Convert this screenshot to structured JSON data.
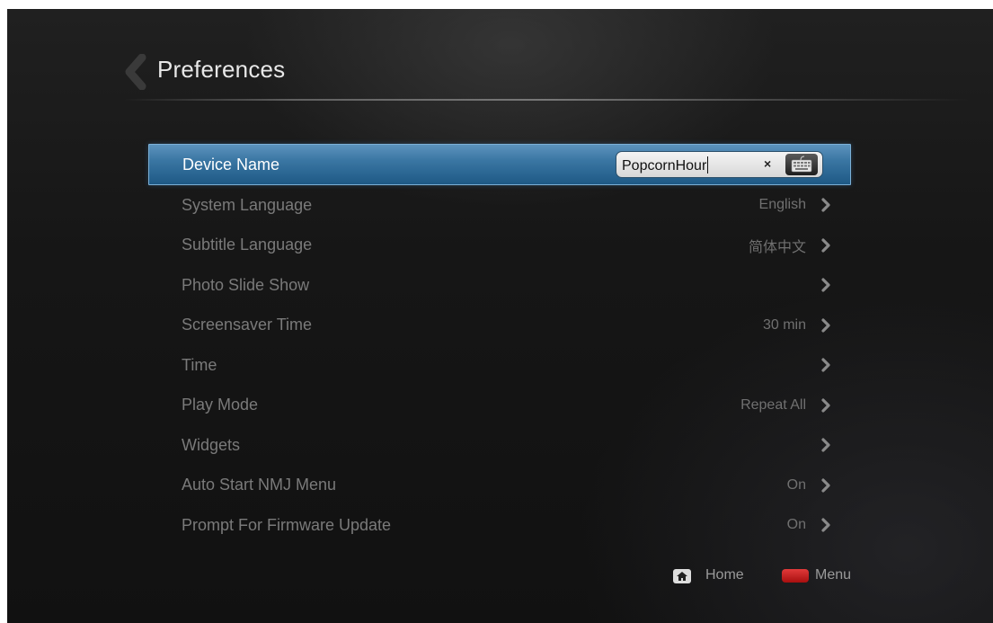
{
  "header": {
    "title": "Preferences"
  },
  "device_name": {
    "value": "PopcornHour",
    "clear_symbol": "×"
  },
  "settings": [
    {
      "label": "Device Name",
      "value": ""
    },
    {
      "label": "System Language",
      "value": "English"
    },
    {
      "label": "Subtitle Language",
      "value": "简体中文"
    },
    {
      "label": "Photo Slide Show",
      "value": ""
    },
    {
      "label": "Screensaver Time",
      "value": "30 min"
    },
    {
      "label": "Time",
      "value": ""
    },
    {
      "label": "Play Mode",
      "value": "Repeat All"
    },
    {
      "label": "Widgets",
      "value": ""
    },
    {
      "label": "Auto Start NMJ Menu",
      "value": "On"
    },
    {
      "label": "Prompt For Firmware Update",
      "value": "On"
    }
  ],
  "footer": {
    "home_label": "Home",
    "menu_label": "Menu"
  },
  "colors": {
    "selection": "#3a76a3",
    "menu_button": "#d22b2b"
  },
  "icons": [
    "back-chevron-icon",
    "keyboard-icon",
    "chevron-right-icon",
    "home-icon",
    "menu-key-icon"
  ]
}
